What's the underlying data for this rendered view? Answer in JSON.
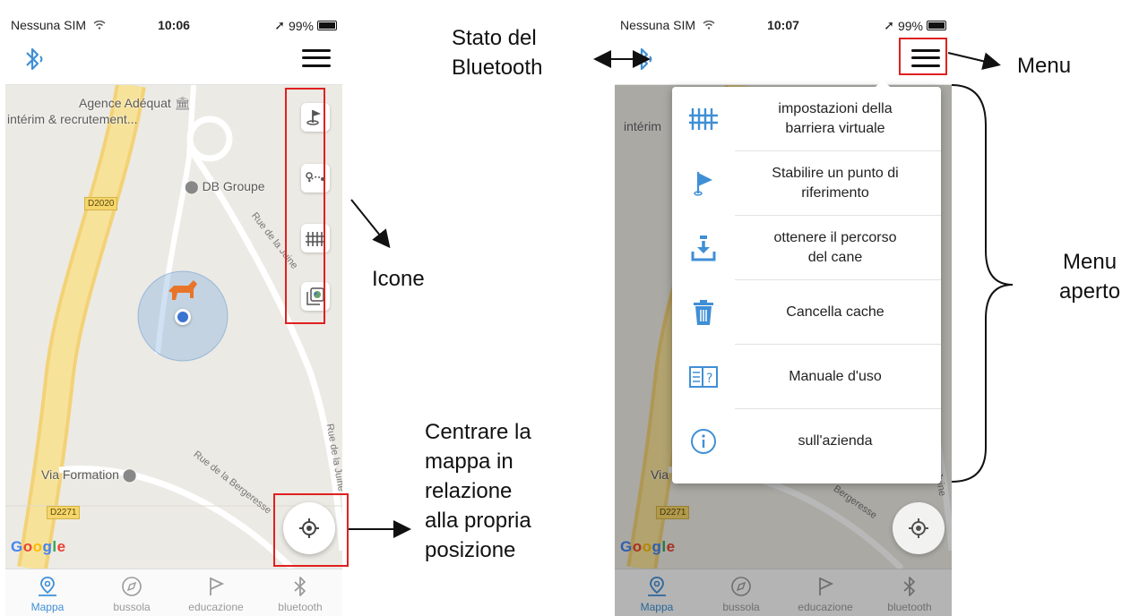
{
  "left_screen": {
    "status": {
      "carrier": "Nessuna SIM",
      "time": "10:06",
      "battery": "99%"
    },
    "map": {
      "poi_agence_line1": "Agence Adéquat",
      "poi_agence_line2": "intérim & recrutement...",
      "poi_db": "DB Groupe",
      "poi_via": "Via Formation",
      "road_d2020": "D2020",
      "road_d2271": "D2271",
      "street_juine": "Rue de la Juine",
      "street_bergeresse": "Rue de la Bergeresse",
      "street_juine2": "Rue de la Juine",
      "google_letters": [
        "G",
        "o",
        "o",
        "g",
        "l",
        "e"
      ]
    },
    "map_icons": [
      "reference-point-flag-icon",
      "dog-track-icon",
      "virtual-fence-icon",
      "map-layers-icon"
    ]
  },
  "right_screen": {
    "status": {
      "carrier": "Nessuna SIM",
      "time": "10:07",
      "battery": "99%"
    },
    "map": {
      "poi_partial_interim": "intérim",
      "poi_partial_via": "Via I",
      "road_d2271": "D2271",
      "street_bergeresse": "Bergeresse",
      "street_juine": "Juine",
      "google_letters": [
        "G",
        "o",
        "o",
        "g",
        "l",
        "e"
      ]
    },
    "menu": {
      "items": [
        {
          "icon": "fence-icon",
          "label_line1": "impostazioni della",
          "label_line2": "barriera virtuale"
        },
        {
          "icon": "flag-icon",
          "label_line1": "Stabilire un punto di",
          "label_line2": "riferimento"
        },
        {
          "icon": "download-track-icon",
          "label_line1": "ottenere il percorso",
          "label_line2": "del cane"
        },
        {
          "icon": "trash-icon",
          "label_line1": "Cancella cache",
          "label_line2": ""
        },
        {
          "icon": "manual-book-icon",
          "label_line1": "Manuale d'uso",
          "label_line2": ""
        },
        {
          "icon": "info-icon",
          "label_line1": "sull'azienda",
          "label_line2": ""
        }
      ]
    }
  },
  "tabs": [
    {
      "label": "Mappa",
      "icon": "map-pin-icon",
      "active": true
    },
    {
      "label": "bussola",
      "icon": "compass-icon",
      "active": false
    },
    {
      "label": "educazione",
      "icon": "flag-outline-icon",
      "active": false
    },
    {
      "label": "bluetooth",
      "icon": "bluetooth-icon",
      "active": false
    }
  ],
  "annotations": {
    "icone": "Icone",
    "centrare": [
      "Centrare la",
      "mappa in",
      "relazione",
      "alla propria",
      "posizione"
    ],
    "stato_bt": [
      "Stato del",
      "Bluetooth"
    ],
    "menu": "Menu",
    "menu_aperto": [
      "Menu",
      "aperto"
    ]
  },
  "colors": {
    "accent_blue": "#3f8fd6",
    "callout_red": "#e02020",
    "road_yellow": "#f6d66a",
    "dog_orange": "#e8742a"
  }
}
